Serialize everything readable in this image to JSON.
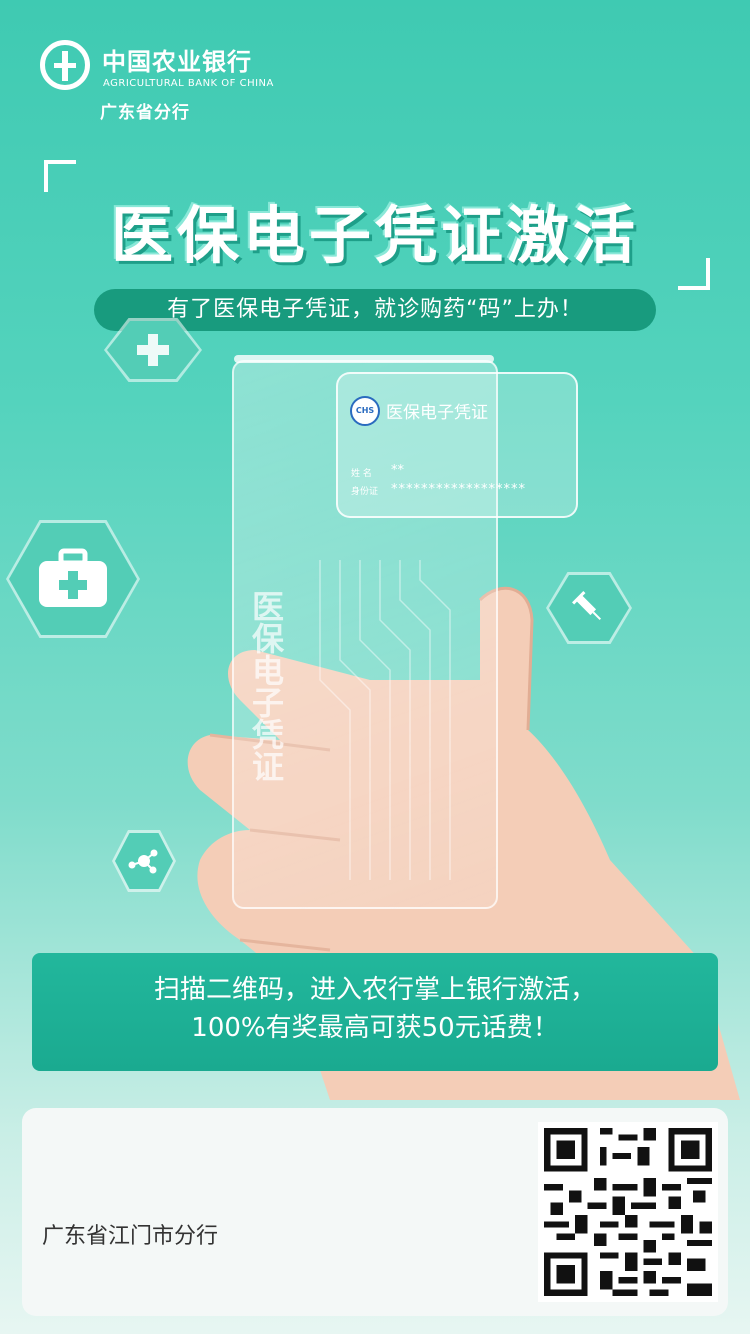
{
  "header": {
    "bank_name_cn": "中国农业银行",
    "bank_name_en": "AGRICULTURAL BANK OF CHINA",
    "branch": "广东省分行"
  },
  "hero": {
    "headline": "医保电子凭证激活",
    "subtitle": "有了医保电子凭证，就诊购药“码”上办！"
  },
  "card": {
    "logo_text": "CHS",
    "title": "医保电子凭证",
    "name_label": "姓 名",
    "name_value": "**",
    "id_label": "身份证",
    "id_value": "******************"
  },
  "phone": {
    "vertical_text": "医保电子凭证"
  },
  "icons": [
    "medical-cross-icon",
    "first-aid-kit-icon",
    "syringe-icon",
    "molecule-icon"
  ],
  "cta": {
    "line1": "扫描二维码，进入农行掌上银行激活，",
    "line2": "100%有奖最高可获50元话费！"
  },
  "footer": {
    "branch": "广东省江门市分行"
  },
  "colors": {
    "primary": "#3fcab2",
    "pill": "#189b7e",
    "cta": "#1aaa90"
  }
}
